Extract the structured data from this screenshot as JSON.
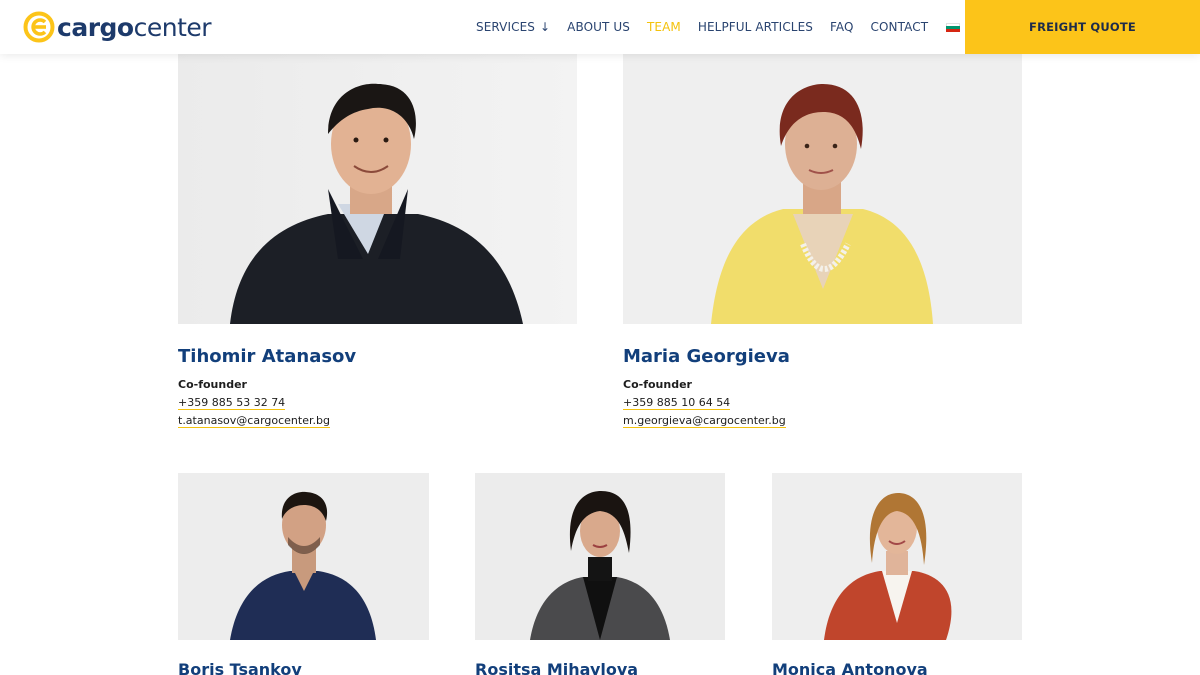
{
  "brand": {
    "logo_bold": "cargo",
    "logo_light": "center",
    "colors": {
      "accent": "#fcc419",
      "primary": "#123f7b",
      "nav": "#2a4470"
    }
  },
  "nav": {
    "items": [
      {
        "label": "SERVICES",
        "has_dropdown": true,
        "arrow": "↓"
      },
      {
        "label": "ABOUT US"
      },
      {
        "label": "TEAM",
        "active": true
      },
      {
        "label": "HELPFUL ARTICLES"
      },
      {
        "label": "FAQ"
      },
      {
        "label": "CONTACT"
      }
    ],
    "language_flag": "bulgarian-flag-icon",
    "cta": "FREIGHT QUOTE"
  },
  "team": {
    "featured": [
      {
        "name": "Tihomir Atanasov",
        "role": "Co-founder",
        "phone": "+359 885 53 32 74",
        "email": "t.atanasov@cargocenter.bg"
      },
      {
        "name": "Maria Georgieva",
        "role": "Co-founder",
        "phone": "+359 885 10 64 54",
        "email": "m.georgieva@cargocenter.bg"
      }
    ],
    "members": [
      {
        "name": "Boris Tsankov"
      },
      {
        "name": "Rositsa Mihaylova"
      },
      {
        "name": "Monica Antonova"
      }
    ]
  }
}
